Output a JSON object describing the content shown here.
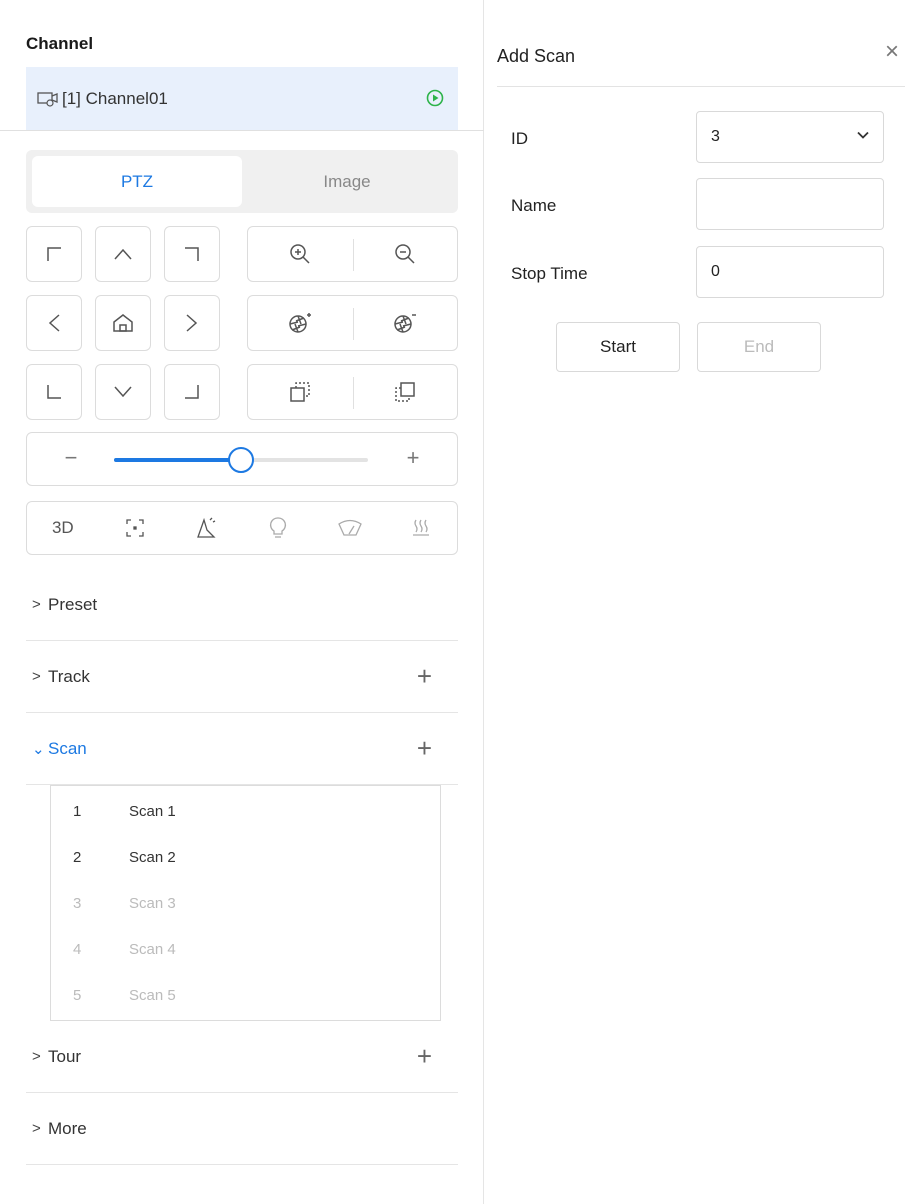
{
  "channel": {
    "title": "Channel",
    "item_label": "[1] Channel01"
  },
  "tabs": [
    {
      "label": "PTZ",
      "active": true
    },
    {
      "label": "Image",
      "active": false
    }
  ],
  "speed": {
    "value_fraction": 0.5,
    "minus": "−",
    "plus": "+"
  },
  "tools": {
    "three_d_label": "3D"
  },
  "sections": {
    "preset": {
      "label": "Preset",
      "chevron": ">"
    },
    "track": {
      "label": "Track",
      "chevron": ">",
      "add": "+"
    },
    "scan": {
      "label": "Scan",
      "chevron": "⌄",
      "add": "+"
    },
    "tour": {
      "label": "Tour",
      "chevron": ">",
      "add": "+"
    },
    "more": {
      "label": "More",
      "chevron": ">"
    }
  },
  "scan_list": [
    {
      "id": "1",
      "name": "Scan 1",
      "enabled": true
    },
    {
      "id": "2",
      "name": "Scan 2",
      "enabled": true
    },
    {
      "id": "3",
      "name": "Scan 3",
      "enabled": false
    },
    {
      "id": "4",
      "name": "Scan 4",
      "enabled": false
    },
    {
      "id": "5",
      "name": "Scan 5",
      "enabled": false
    }
  ],
  "dialog": {
    "title": "Add Scan",
    "close": "×",
    "id_label": "ID",
    "id_value": "3",
    "name_label": "Name",
    "name_value": "",
    "stop_time_label": "Stop Time",
    "stop_time_value": "0",
    "start_label": "Start",
    "end_label": "End"
  },
  "colors": {
    "accent": "#1d79e2",
    "selected_row_bg": "#e8f0fc",
    "play_icon": "#2db34a"
  }
}
